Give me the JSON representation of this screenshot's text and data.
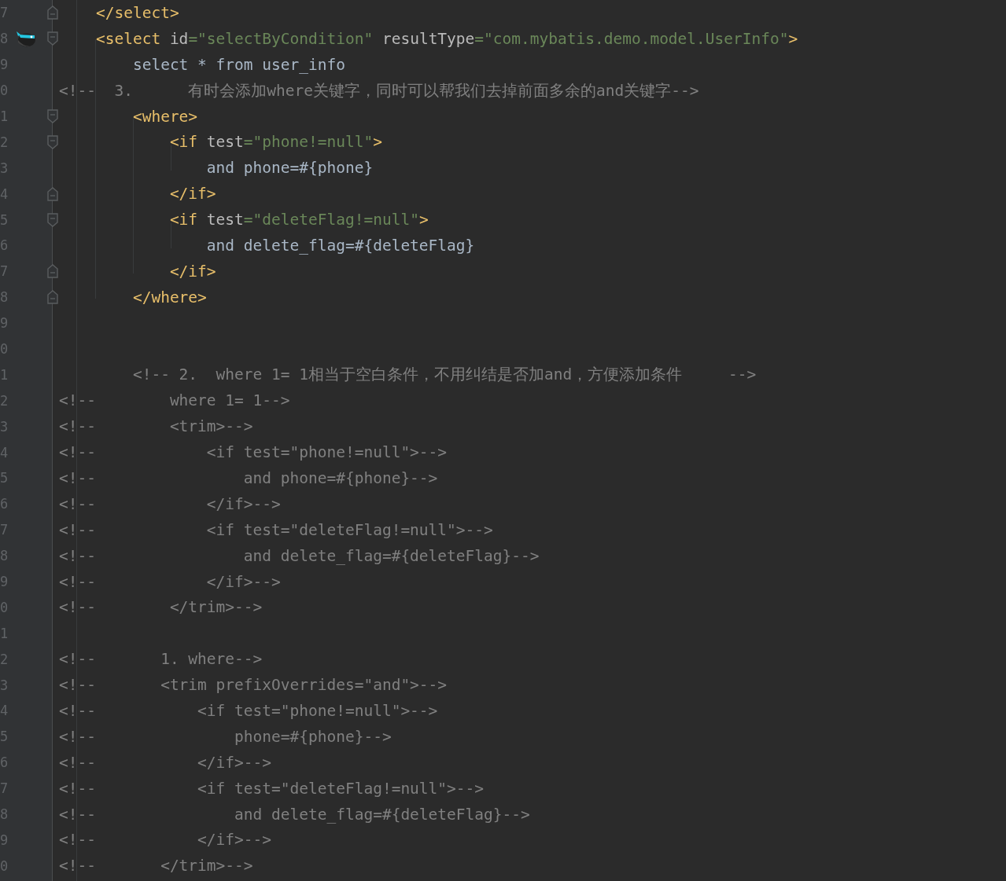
{
  "editor": {
    "lines": [
      {
        "number": "7",
        "fold_start": false,
        "fold_end": true,
        "marker": false,
        "tokens": [
          {
            "text": "    </select>",
            "kind": "tag"
          }
        ]
      },
      {
        "number": "8",
        "fold_start": true,
        "fold_end": false,
        "marker": true,
        "tokens": [
          {
            "text": "    <select",
            "kind": "tag"
          },
          {
            "text": " id",
            "kind": "attr"
          },
          {
            "text": "=\"selectByCondition\"",
            "kind": "value"
          },
          {
            "text": " resultType",
            "kind": "attr"
          },
          {
            "text": "=\"com.mybatis.demo.model.UserInfo\"",
            "kind": "value"
          },
          {
            "text": ">",
            "kind": "tag"
          }
        ]
      },
      {
        "number": "9",
        "fold_start": false,
        "fold_end": false,
        "marker": false,
        "tokens": [
          {
            "text": "        select * from user_info",
            "kind": "text"
          }
        ]
      },
      {
        "number": "0",
        "fold_start": false,
        "fold_end": false,
        "marker": false,
        "tokens": [
          {
            "text": "<!--  3.      有时会添加where关键字，同时可以帮我们去掉前面多余的and关键字-->",
            "kind": "comment"
          }
        ]
      },
      {
        "number": "1",
        "fold_start": true,
        "fold_end": false,
        "marker": false,
        "tokens": [
          {
            "text": "        <where>",
            "kind": "tag"
          }
        ]
      },
      {
        "number": "2",
        "fold_start": true,
        "fold_end": false,
        "marker": false,
        "tokens": [
          {
            "text": "            <if",
            "kind": "tag"
          },
          {
            "text": " test",
            "kind": "attr"
          },
          {
            "text": "=\"phone!=null\"",
            "kind": "value"
          },
          {
            "text": ">",
            "kind": "tag"
          }
        ]
      },
      {
        "number": "3",
        "fold_start": false,
        "fold_end": false,
        "marker": false,
        "tokens": [
          {
            "text": "                and phone=#{phone}",
            "kind": "text"
          }
        ]
      },
      {
        "number": "4",
        "fold_start": false,
        "fold_end": true,
        "marker": false,
        "tokens": [
          {
            "text": "            </if>",
            "kind": "tag"
          }
        ]
      },
      {
        "number": "5",
        "fold_start": true,
        "fold_end": false,
        "marker": false,
        "tokens": [
          {
            "text": "            <if",
            "kind": "tag"
          },
          {
            "text": " test",
            "kind": "attr"
          },
          {
            "text": "=\"deleteFlag!=null\"",
            "kind": "value"
          },
          {
            "text": ">",
            "kind": "tag"
          }
        ]
      },
      {
        "number": "6",
        "fold_start": false,
        "fold_end": false,
        "marker": false,
        "tokens": [
          {
            "text": "                and delete_flag=#{deleteFlag}",
            "kind": "text"
          }
        ]
      },
      {
        "number": "7",
        "fold_start": false,
        "fold_end": true,
        "marker": false,
        "tokens": [
          {
            "text": "            </if>",
            "kind": "tag"
          }
        ]
      },
      {
        "number": "8",
        "fold_start": false,
        "fold_end": true,
        "marker": false,
        "tokens": [
          {
            "text": "        </where>",
            "kind": "tag"
          }
        ]
      },
      {
        "number": "9",
        "fold_start": false,
        "fold_end": false,
        "marker": false
      },
      {
        "number": "0",
        "fold_start": false,
        "fold_end": false,
        "marker": false
      },
      {
        "number": "1",
        "fold_start": false,
        "fold_end": false,
        "marker": false,
        "tokens": [
          {
            "text": "        <!-- 2.  where 1= 1相当于空白条件，不用纠结是否加and，方便添加条件     -->",
            "kind": "comment"
          }
        ]
      },
      {
        "number": "2",
        "fold_start": false,
        "fold_end": false,
        "marker": false,
        "tokens": [
          {
            "text": "<!--        where 1= 1-->",
            "kind": "comment"
          }
        ]
      },
      {
        "number": "3",
        "fold_start": false,
        "fold_end": false,
        "marker": false,
        "tokens": [
          {
            "text": "<!--        <trim>-->",
            "kind": "comment"
          }
        ]
      },
      {
        "number": "4",
        "fold_start": false,
        "fold_end": false,
        "marker": false,
        "tokens": [
          {
            "text": "<!--            <if test=\"phone!=null\">-->",
            "kind": "comment"
          }
        ]
      },
      {
        "number": "5",
        "fold_start": false,
        "fold_end": false,
        "marker": false,
        "tokens": [
          {
            "text": "<!--                and phone=#{phone}-->",
            "kind": "comment"
          }
        ]
      },
      {
        "number": "6",
        "fold_start": false,
        "fold_end": false,
        "marker": false,
        "tokens": [
          {
            "text": "<!--            </if>-->",
            "kind": "comment"
          }
        ]
      },
      {
        "number": "7",
        "fold_start": false,
        "fold_end": false,
        "marker": false,
        "tokens": [
          {
            "text": "<!--            <if test=\"deleteFlag!=null\">-->",
            "kind": "comment"
          }
        ]
      },
      {
        "number": "8",
        "fold_start": false,
        "fold_end": false,
        "marker": false,
        "tokens": [
          {
            "text": "<!--                and delete_flag=#{deleteFlag}-->",
            "kind": "comment"
          }
        ]
      },
      {
        "number": "9",
        "fold_start": false,
        "fold_end": false,
        "marker": false,
        "tokens": [
          {
            "text": "<!--            </if>-->",
            "kind": "comment"
          }
        ]
      },
      {
        "number": "0",
        "fold_start": false,
        "fold_end": false,
        "marker": false,
        "tokens": [
          {
            "text": "<!--        </trim>-->",
            "kind": "comment"
          }
        ]
      },
      {
        "number": "1",
        "fold_start": false,
        "fold_end": false,
        "marker": false
      },
      {
        "number": "2",
        "fold_start": false,
        "fold_end": false,
        "marker": false,
        "tokens": [
          {
            "text": "<!--       1. where-->",
            "kind": "comment"
          }
        ]
      },
      {
        "number": "3",
        "fold_start": false,
        "fold_end": false,
        "marker": false,
        "tokens": [
          {
            "text": "<!--       <trim prefixOverrides=\"and\">-->",
            "kind": "comment"
          }
        ]
      },
      {
        "number": "4",
        "fold_start": false,
        "fold_end": false,
        "marker": false,
        "tokens": [
          {
            "text": "<!--           <if test=\"phone!=null\">-->",
            "kind": "comment"
          }
        ]
      },
      {
        "number": "5",
        "fold_start": false,
        "fold_end": false,
        "marker": false,
        "tokens": [
          {
            "text": "<!--               phone=#{phone}-->",
            "kind": "comment"
          }
        ]
      },
      {
        "number": "6",
        "fold_start": false,
        "fold_end": false,
        "marker": false,
        "tokens": [
          {
            "text": "<!--           </if>-->",
            "kind": "comment"
          }
        ]
      },
      {
        "number": "7",
        "fold_start": false,
        "fold_end": false,
        "marker": false,
        "tokens": [
          {
            "text": "<!--           <if test=\"deleteFlag!=null\">-->",
            "kind": "comment"
          }
        ]
      },
      {
        "number": "8",
        "fold_start": false,
        "fold_end": false,
        "marker": false,
        "tokens": [
          {
            "text": "<!--               and delete_flag=#{deleteFlag}-->",
            "kind": "comment"
          }
        ]
      },
      {
        "number": "9",
        "fold_start": false,
        "fold_end": false,
        "marker": false,
        "tokens": [
          {
            "text": "<!--           </if>-->",
            "kind": "comment"
          }
        ]
      },
      {
        "number": "0",
        "fold_start": false,
        "fold_end": false,
        "marker": false,
        "tokens": [
          {
            "text": "<!--       </trim>-->",
            "kind": "comment"
          }
        ]
      }
    ]
  }
}
